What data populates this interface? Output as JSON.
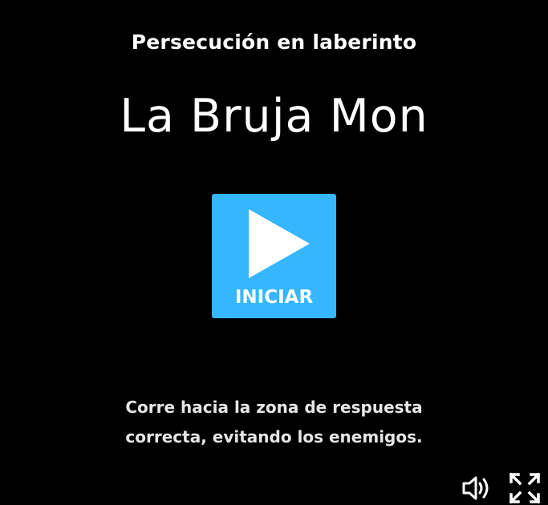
{
  "game": {
    "subtitle": "Persecución en laberinto",
    "title": "La Bruja Mon",
    "start_label": "INICIAR",
    "instructions": [
      "Corre hacia la zona de respuesta",
      "correcta, evitando los enemigos."
    ]
  },
  "controls": {
    "sound_icon": "speaker-icon",
    "fullscreen_icon": "fullscreen-icon"
  },
  "colors": {
    "background": "#000000",
    "accent": "#36b6ff",
    "text": "#ffffff"
  }
}
